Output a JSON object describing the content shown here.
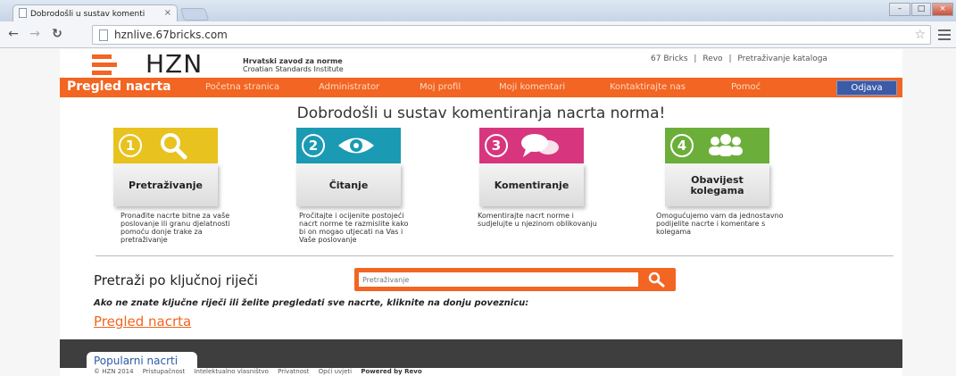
{
  "browser": {
    "tab_title": "Dobrodošli u sustav komenti",
    "tab_close": "×",
    "url": "hznlive.67bricks.com"
  },
  "header": {
    "logo": "HZN",
    "institute_hr": "Hrvatski zavod za norme",
    "institute_en": "Croatian Standards Institute",
    "top_links": [
      "67 Bricks",
      "Revo",
      "Pretraživanje kataloga"
    ],
    "separator": "|"
  },
  "nav": {
    "title": "Pregled nacrta",
    "items": [
      "Početna stranica",
      "Administrator",
      "Moj profil",
      "Moji komentari",
      "Kontaktirajte nas",
      "Pomoć"
    ],
    "logout": "Odjava"
  },
  "main": {
    "welcome": "Dobrodošli u sustav komentiranja nacrta norma!",
    "cards": [
      {
        "number": "1",
        "label": "Pretraživanje",
        "icon": "magnifier-icon",
        "color": "#e8c21e",
        "desc": "Pronađite nacrte bitne za vaše poslovanje ili granu djelatnosti pomoću donje trake za pretraživanje"
      },
      {
        "number": "2",
        "label": "Čitanje",
        "icon": "eye-icon",
        "color": "#1b9ab3",
        "desc": "Pročitajte i ocijenite postojeći nacrt norme te razmislite kako bi on mogao utjecati na Vas i Vaše poslovanje"
      },
      {
        "number": "3",
        "label": "Komentiranje",
        "icon": "speech-bubbles-icon",
        "color": "#d7367f",
        "desc": "Komentirajte nacrt norme i sudjelujte u njezinom oblikovanju"
      },
      {
        "number": "4",
        "label": "Obavijest kolegama",
        "icon": "people-icon",
        "color": "#6cae3a",
        "desc": "Omogućujemo vam da jednostavno podijelite nacrte i komentare s kolegama"
      }
    ],
    "search_label": "Pretraži po ključnoj riječi",
    "search_placeholder": "Pretraživanje",
    "hint": "Ako ne znate ključne riječi ili želite pregledati sve nacrte, kliknite na donju poveznicu:",
    "browse_link": "Pregled nacrta"
  },
  "footer": {
    "popular_tab": "Popularni nacrti",
    "copyright": "© HZN 2014",
    "links": [
      "Pristupačnost",
      "Intelektualno vlasništvo",
      "Privatnost",
      "Opći uvjeti"
    ],
    "powered": "Powered by Revo"
  },
  "colors": {
    "accent": "#f26522",
    "logout": "#3b5ba8",
    "footer": "#3e3e3e"
  }
}
